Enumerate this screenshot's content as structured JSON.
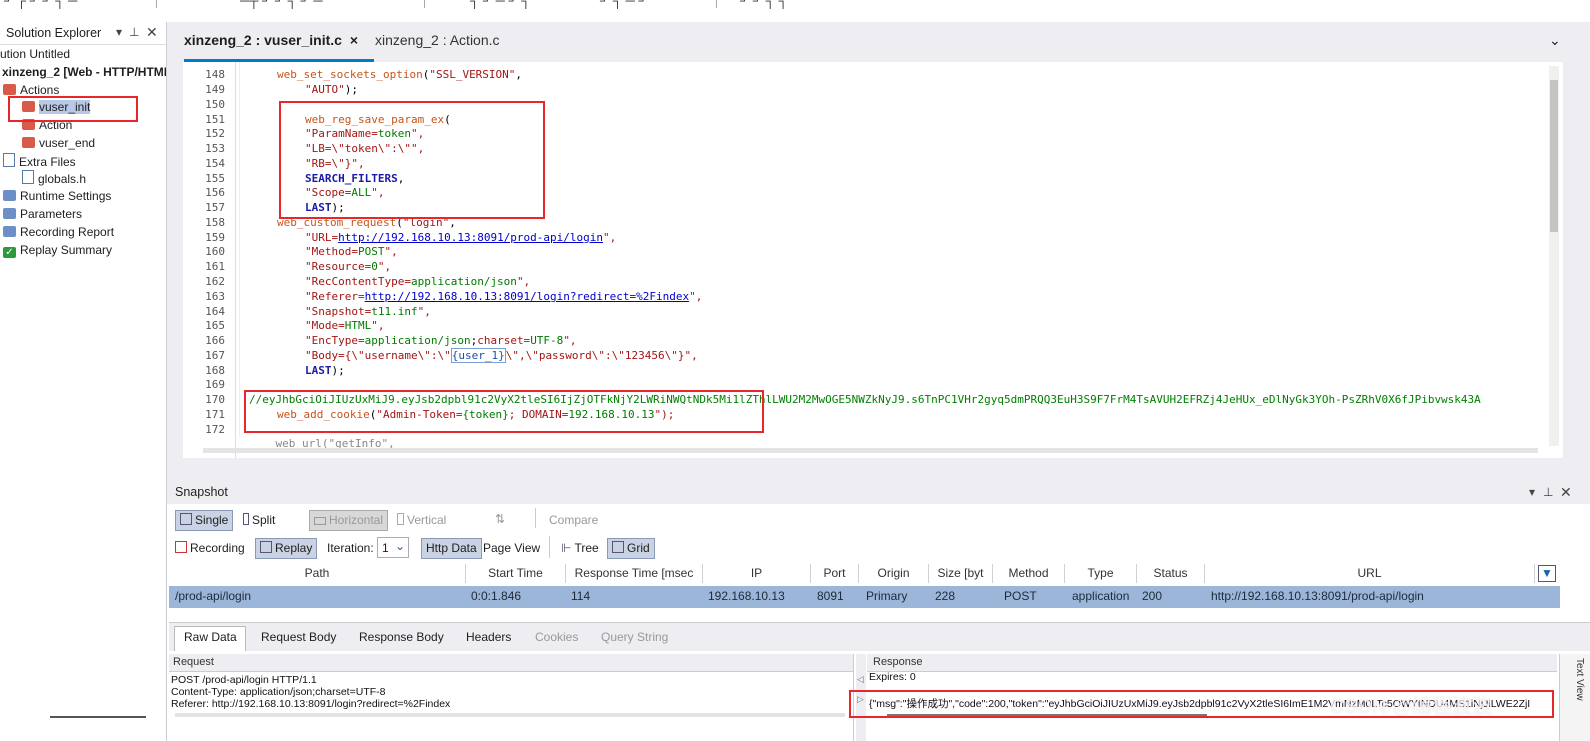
{
  "top_strip": {
    "fragments": [
      "┘ ┌ ┘ ┘  ┐ ─",
      "─┬  ┘ ┘ ┐ ┘ ─",
      "┐ ┘   ─ ┘ ┐",
      "┘ ┐ ─ ┘",
      "┘ ┘  ┐ ┐"
    ]
  },
  "solution_explorer": {
    "title": "Solution Explorer",
    "items": [
      {
        "label": "ution Untitled"
      },
      {
        "label": "xinzeng_2 [Web - HTTP/HTML"
      },
      {
        "label": "Actions",
        "icon": "actions-icon"
      },
      {
        "label": "vuser_init",
        "icon": "script-icon"
      },
      {
        "label": "Action",
        "icon": "script-icon"
      },
      {
        "label": "vuser_end",
        "icon": "script-icon"
      },
      {
        "label": "Extra Files",
        "icon": "folder-icon"
      },
      {
        "label": "globals.h",
        "icon": "file-icon"
      },
      {
        "label": "Runtime Settings",
        "icon": "settings-icon"
      },
      {
        "label": "Parameters",
        "icon": "parameters-icon"
      },
      {
        "label": "Recording Report",
        "icon": "report-icon"
      },
      {
        "label": "Replay Summary",
        "icon": "check-icon"
      }
    ]
  },
  "editor": {
    "tabs": [
      {
        "label": "xinzeng_2 : vuser_init.c",
        "close": "×"
      },
      {
        "label": "xinzeng_2 : Action.c"
      }
    ],
    "chevron": "⌄",
    "line_numbers": [
      "148",
      "149",
      "150",
      "151",
      "152",
      "153",
      "154",
      "155",
      "156",
      "157",
      "158",
      "159",
      "160",
      "161",
      "162",
      "163",
      "164",
      "165",
      "166",
      "167",
      "168",
      "169",
      "170",
      "171",
      "172"
    ],
    "code": {
      "l148_fn": "web_set_sockets_option",
      "l148_open": "(",
      "l148_arg": "\"SSL_VERSION\"",
      "l148_end": ",",
      "l149_arg": "\"AUTO\"",
      "l149_end": ");",
      "l151_fn": "web_reg_save_param_ex",
      "l151_open": "(",
      "l152_key": "\"ParamName=",
      "l152_val": "token",
      "l152_end": "\",",
      "l153_text": "\"LB=\\\"token\\\":\\\"\",",
      "l154_text": "\"RB=\\\"}\",",
      "l155_kw": "SEARCH_FILTERS",
      "l155_end": ",",
      "l156_key": "\"Scope=",
      "l156_val": "ALL",
      "l156_end": "\",",
      "l157_kw": "LAST",
      "l157_end": ");",
      "l158_fn": "web_custom_request",
      "l158_open": "(",
      "l158_arg": "\"login\"",
      "l158_end": ",",
      "l159_key": "\"URL=",
      "l159_link": "http://192.168.10.13:8091/prod-api/login",
      "l159_end": "\",",
      "l160_key": "\"Method=",
      "l160_val": "POST",
      "l160_end": "\",",
      "l161_key": "\"Resource=",
      "l161_val": "0",
      "l161_end": "\",",
      "l162_key": "\"RecContentType=",
      "l162_val": "application/json",
      "l162_end": "\",",
      "l163_key": "\"Referer=",
      "l163_link": "http://192.168.10.13:8091/login?redirect=%2Findex",
      "l163_end": "\",",
      "l164_key": "\"Snapshot=",
      "l164_val": "t11.inf",
      "l164_end": "\",",
      "l165_key": "\"Mode=",
      "l165_val": "HTML",
      "l165_end": "\",",
      "l166_key": "\"EncType=",
      "l166_val": "application/json",
      "l166_semi": ";",
      "l166_key2": "charset=",
      "l166_val2": "UTF-8",
      "l166_end": "\",",
      "l167_key": "\"Body=",
      "l167_v1": "{\\\"username\\\":\\\"",
      "l167_param": "{user_1}",
      "l167_v2": "\\\",\\\"password\\\":\\\"123456\\\"}",
      "l167_end": "\",",
      "l168_kw": "LAST",
      "l168_end": ");",
      "l170_comment": "//eyJhbGciOiJIUzUxMiJ9.eyJsb2dpbl91c2VyX2tleSI6IjZjOTFkNjY2LWRiNWQtNDk5Mi1lZThlLWU2M2MwOGE5NWZkNyJ9.s6TnPC1VHr2gyq5dmPRQQ3EuH3S9F7FrM4TsAVUH2EFRZj4JeHUx_eDlNyGk3YOh-PsZRhV0X6fJPibvwsk43A",
      "l171_fn": "web_add_cookie",
      "l171_open": "(",
      "l171_key": "\"Admin-Token=",
      "l171_val": "{token}",
      "l171_mid": "; DOMAIN=",
      "l171_val2": "192.168.10.13",
      "l171_end": "\");",
      "l173_partial": "    web_url(\"getInfo\","
    }
  },
  "snapshot": {
    "title": "Snapshot",
    "toolbar1": {
      "single": "Single",
      "split": "Split",
      "horizontal": "Horizontal",
      "vertical": "Vertical",
      "compare": "Compare"
    },
    "toolbar2": {
      "recording": "Recording",
      "replay": "Replay",
      "iteration_label": "Iteration:",
      "iteration_value": "1",
      "http_data": "Http Data",
      "page_view": "Page View",
      "tree": "Tree",
      "grid": "Grid"
    },
    "grid": {
      "columns": [
        "Path",
        "Start Time",
        "Response Time [msec",
        "IP",
        "Port",
        "Origin",
        "Size [byt",
        "Method",
        "Type",
        "Status",
        "URL"
      ],
      "rows": [
        {
          "path": "/prod-api/login",
          "start": "0:0:1.846",
          "resp": "114",
          "ip": "192.168.10.13",
          "port": "8091",
          "origin": "Primary",
          "size": "228",
          "method": "POST",
          "type": "application",
          "status": "200",
          "url": "http://192.168.10.13:8091/prod-api/login"
        }
      ]
    },
    "bottom_tabs": [
      "Raw Data",
      "Request Body",
      "Response Body",
      "Headers",
      "Cookies",
      "Query String"
    ],
    "request": {
      "title": "Request",
      "lines": [
        "POST /prod-api/login HTTP/1.1",
        "Content-Type: application/json;charset=UTF-8",
        "Referer: http://192.168.10.13:8091/login?redirect=%2Findex"
      ]
    },
    "response": {
      "title": "Response",
      "expires": "Expires: 0",
      "body": "{\"msg\":\"操作成功\",\"code\":200,\"token\":\"eyJhbGciOiJIUzUxMiJ9.eyJsb2dpbl91c2VyX2tleSI6ImE1M2VmNzM0LTc5OWYtNDU4MS1iNjJlLWE2ZjI",
      "side_tab": "Text View"
    },
    "watermark": "CSDN @编程波波"
  },
  "colors": {
    "accent": "#007acc",
    "highlight_box": "#e8272b",
    "selected_row": "#9bb6d8"
  }
}
